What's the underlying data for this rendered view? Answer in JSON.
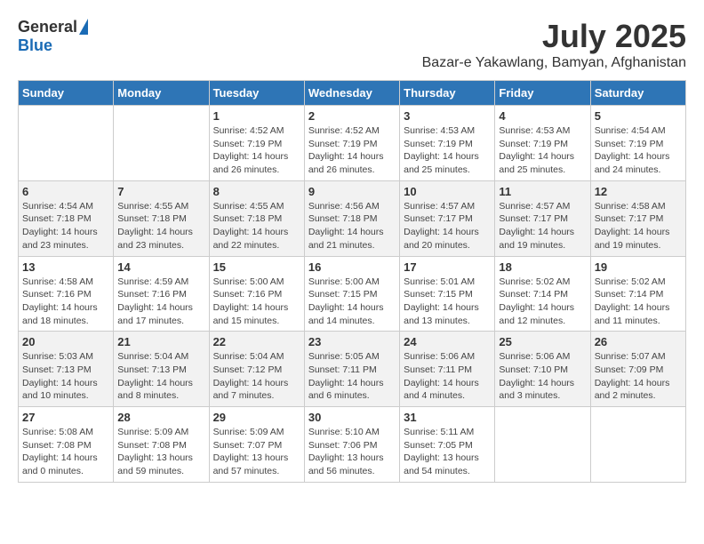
{
  "header": {
    "logo_general": "General",
    "logo_blue": "Blue",
    "month": "July 2025",
    "location": "Bazar-e Yakawlang, Bamyan, Afghanistan"
  },
  "weekdays": [
    "Sunday",
    "Monday",
    "Tuesday",
    "Wednesday",
    "Thursday",
    "Friday",
    "Saturday"
  ],
  "weeks": [
    [
      {
        "day": "",
        "info": ""
      },
      {
        "day": "",
        "info": ""
      },
      {
        "day": "1",
        "info": "Sunrise: 4:52 AM\nSunset: 7:19 PM\nDaylight: 14 hours and 26 minutes."
      },
      {
        "day": "2",
        "info": "Sunrise: 4:52 AM\nSunset: 7:19 PM\nDaylight: 14 hours and 26 minutes."
      },
      {
        "day": "3",
        "info": "Sunrise: 4:53 AM\nSunset: 7:19 PM\nDaylight: 14 hours and 25 minutes."
      },
      {
        "day": "4",
        "info": "Sunrise: 4:53 AM\nSunset: 7:19 PM\nDaylight: 14 hours and 25 minutes."
      },
      {
        "day": "5",
        "info": "Sunrise: 4:54 AM\nSunset: 7:19 PM\nDaylight: 14 hours and 24 minutes."
      }
    ],
    [
      {
        "day": "6",
        "info": "Sunrise: 4:54 AM\nSunset: 7:18 PM\nDaylight: 14 hours and 23 minutes."
      },
      {
        "day": "7",
        "info": "Sunrise: 4:55 AM\nSunset: 7:18 PM\nDaylight: 14 hours and 23 minutes."
      },
      {
        "day": "8",
        "info": "Sunrise: 4:55 AM\nSunset: 7:18 PM\nDaylight: 14 hours and 22 minutes."
      },
      {
        "day": "9",
        "info": "Sunrise: 4:56 AM\nSunset: 7:18 PM\nDaylight: 14 hours and 21 minutes."
      },
      {
        "day": "10",
        "info": "Sunrise: 4:57 AM\nSunset: 7:17 PM\nDaylight: 14 hours and 20 minutes."
      },
      {
        "day": "11",
        "info": "Sunrise: 4:57 AM\nSunset: 7:17 PM\nDaylight: 14 hours and 19 minutes."
      },
      {
        "day": "12",
        "info": "Sunrise: 4:58 AM\nSunset: 7:17 PM\nDaylight: 14 hours and 19 minutes."
      }
    ],
    [
      {
        "day": "13",
        "info": "Sunrise: 4:58 AM\nSunset: 7:16 PM\nDaylight: 14 hours and 18 minutes."
      },
      {
        "day": "14",
        "info": "Sunrise: 4:59 AM\nSunset: 7:16 PM\nDaylight: 14 hours and 17 minutes."
      },
      {
        "day": "15",
        "info": "Sunrise: 5:00 AM\nSunset: 7:16 PM\nDaylight: 14 hours and 15 minutes."
      },
      {
        "day": "16",
        "info": "Sunrise: 5:00 AM\nSunset: 7:15 PM\nDaylight: 14 hours and 14 minutes."
      },
      {
        "day": "17",
        "info": "Sunrise: 5:01 AM\nSunset: 7:15 PM\nDaylight: 14 hours and 13 minutes."
      },
      {
        "day": "18",
        "info": "Sunrise: 5:02 AM\nSunset: 7:14 PM\nDaylight: 14 hours and 12 minutes."
      },
      {
        "day": "19",
        "info": "Sunrise: 5:02 AM\nSunset: 7:14 PM\nDaylight: 14 hours and 11 minutes."
      }
    ],
    [
      {
        "day": "20",
        "info": "Sunrise: 5:03 AM\nSunset: 7:13 PM\nDaylight: 14 hours and 10 minutes."
      },
      {
        "day": "21",
        "info": "Sunrise: 5:04 AM\nSunset: 7:13 PM\nDaylight: 14 hours and 8 minutes."
      },
      {
        "day": "22",
        "info": "Sunrise: 5:04 AM\nSunset: 7:12 PM\nDaylight: 14 hours and 7 minutes."
      },
      {
        "day": "23",
        "info": "Sunrise: 5:05 AM\nSunset: 7:11 PM\nDaylight: 14 hours and 6 minutes."
      },
      {
        "day": "24",
        "info": "Sunrise: 5:06 AM\nSunset: 7:11 PM\nDaylight: 14 hours and 4 minutes."
      },
      {
        "day": "25",
        "info": "Sunrise: 5:06 AM\nSunset: 7:10 PM\nDaylight: 14 hours and 3 minutes."
      },
      {
        "day": "26",
        "info": "Sunrise: 5:07 AM\nSunset: 7:09 PM\nDaylight: 14 hours and 2 minutes."
      }
    ],
    [
      {
        "day": "27",
        "info": "Sunrise: 5:08 AM\nSunset: 7:08 PM\nDaylight: 14 hours and 0 minutes."
      },
      {
        "day": "28",
        "info": "Sunrise: 5:09 AM\nSunset: 7:08 PM\nDaylight: 13 hours and 59 minutes."
      },
      {
        "day": "29",
        "info": "Sunrise: 5:09 AM\nSunset: 7:07 PM\nDaylight: 13 hours and 57 minutes."
      },
      {
        "day": "30",
        "info": "Sunrise: 5:10 AM\nSunset: 7:06 PM\nDaylight: 13 hours and 56 minutes."
      },
      {
        "day": "31",
        "info": "Sunrise: 5:11 AM\nSunset: 7:05 PM\nDaylight: 13 hours and 54 minutes."
      },
      {
        "day": "",
        "info": ""
      },
      {
        "day": "",
        "info": ""
      }
    ]
  ]
}
